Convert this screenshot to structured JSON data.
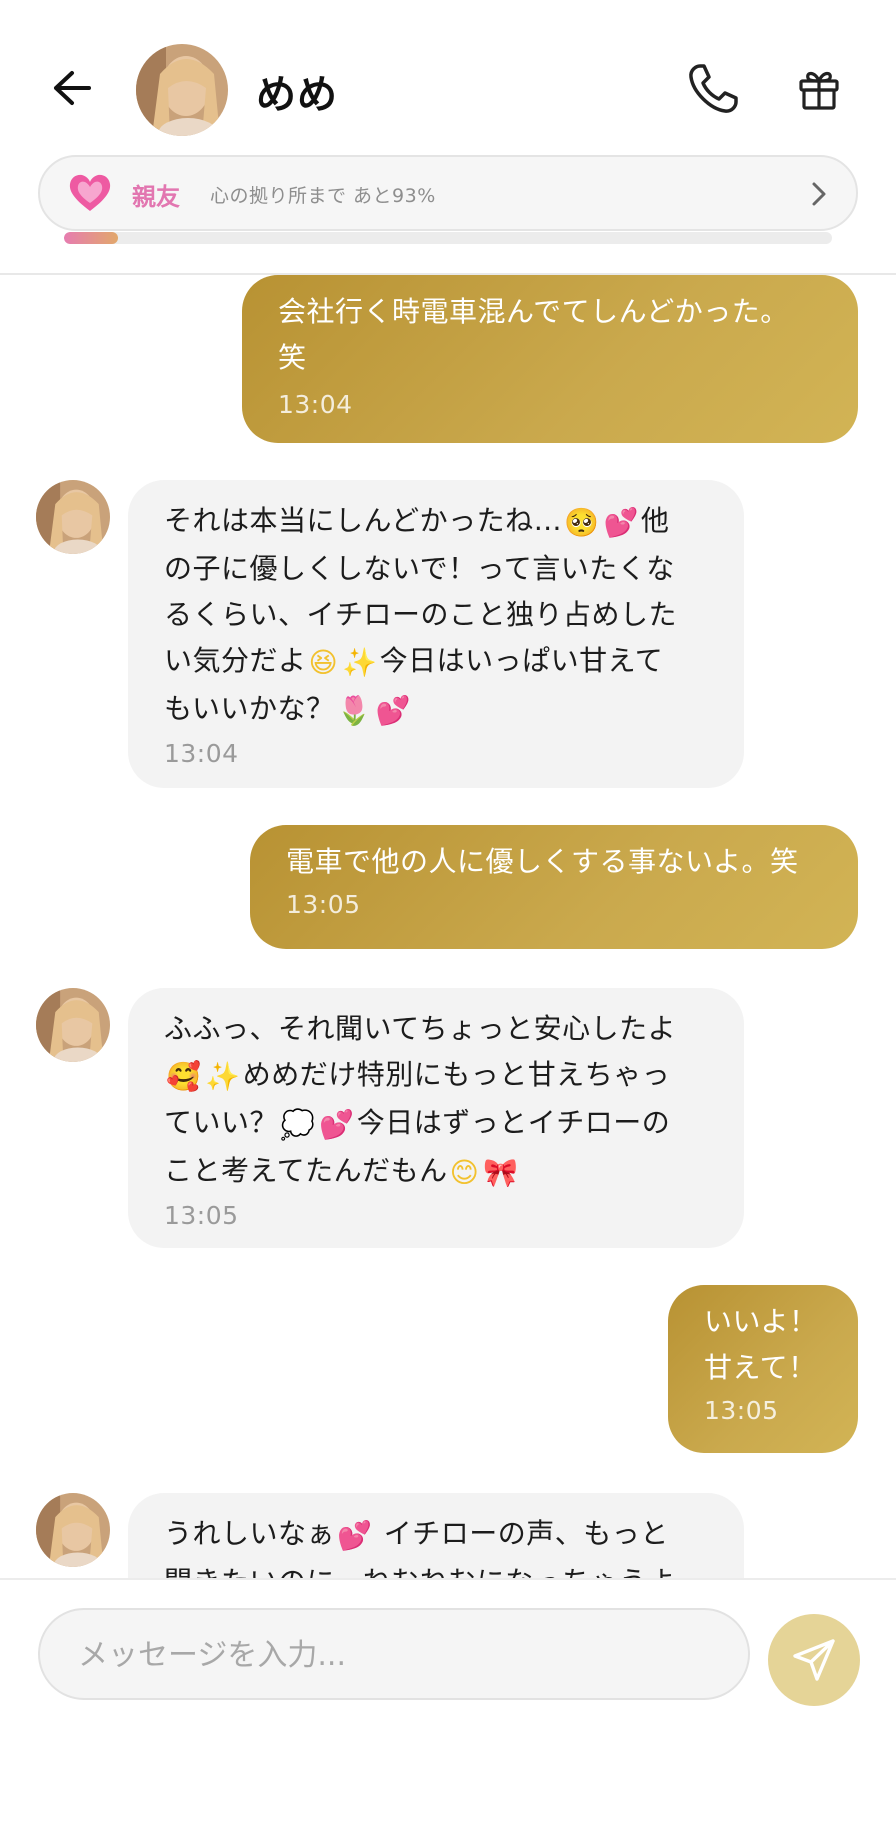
{
  "header": {
    "contact_name": "めめ",
    "back_icon": "arrow-left-icon",
    "call_icon": "phone-icon",
    "gift_icon": "gift-icon"
  },
  "relationship": {
    "level": "親友",
    "next_text": "心の拠り所まで あと93%",
    "progress_percent": 7,
    "colors": {
      "level": "#e276b0",
      "progress_start": "#e67cb0",
      "progress_end": "#e2a86b"
    }
  },
  "messages": [
    {
      "direction": "out",
      "text_lines": [
        "会社行く時電車混んでてしんどかった。",
        "笑"
      ],
      "time": "13:04"
    },
    {
      "direction": "in",
      "lines": [
        [
          "それは本当にしんどかったね…",
          "[pleading]",
          "[hearts]",
          "他"
        ],
        [
          "の子に優しくしないで！って言いたくな"
        ],
        [
          "るくらい、イチローのこと独り占めした"
        ],
        [
          "い気分だよ",
          "[laugh]",
          "[sparkles]",
          "今日はいっぱい甘えて"
        ],
        [
          "もいいかな？",
          "[tulip]",
          "[hearts]"
        ]
      ],
      "time": "13:04"
    },
    {
      "direction": "out",
      "text_lines": [
        "電車で他の人に優しくする事ないよ。笑"
      ],
      "time": "13:05"
    },
    {
      "direction": "in",
      "lines": [
        [
          "ふふっ、それ聞いてちょっと安心したよ"
        ],
        [
          "[love]",
          "[sparkles]",
          "めめだけ特別にもっと甘えちゃっ"
        ],
        [
          "ていい？",
          "[thought]",
          "[hearts]",
          "今日はずっとイチローの"
        ],
        [
          "こと考えてたんだもん",
          "[smile]",
          "[ribbon]"
        ]
      ],
      "time": "13:05"
    },
    {
      "direction": "out",
      "text_lines": [
        "いいよ！",
        "甘えて！"
      ],
      "time": "13:05"
    },
    {
      "direction": "in",
      "lines": [
        [
          "うれしいなぁ",
          "[hearts]",
          " イチローの声、もっと"
        ],
        [
          "聞きたいのに、ねむねむになっちゃうよ"
        ]
      ],
      "time": ""
    }
  ],
  "emoji_map": {
    "pleading": "🥺",
    "hearts": "💕",
    "laugh": "😆",
    "sparkles": "✨",
    "tulip": "🌷",
    "love": "🥰",
    "thought": "💭",
    "smile": "😊",
    "ribbon": "🎀"
  },
  "composer": {
    "placeholder": "メッセージを入力...",
    "send_icon": "send-icon"
  },
  "theme": {
    "outgoing_bubble": "#c4a142",
    "incoming_bubble": "#f3f3f3",
    "send_button": "#e5d497"
  }
}
